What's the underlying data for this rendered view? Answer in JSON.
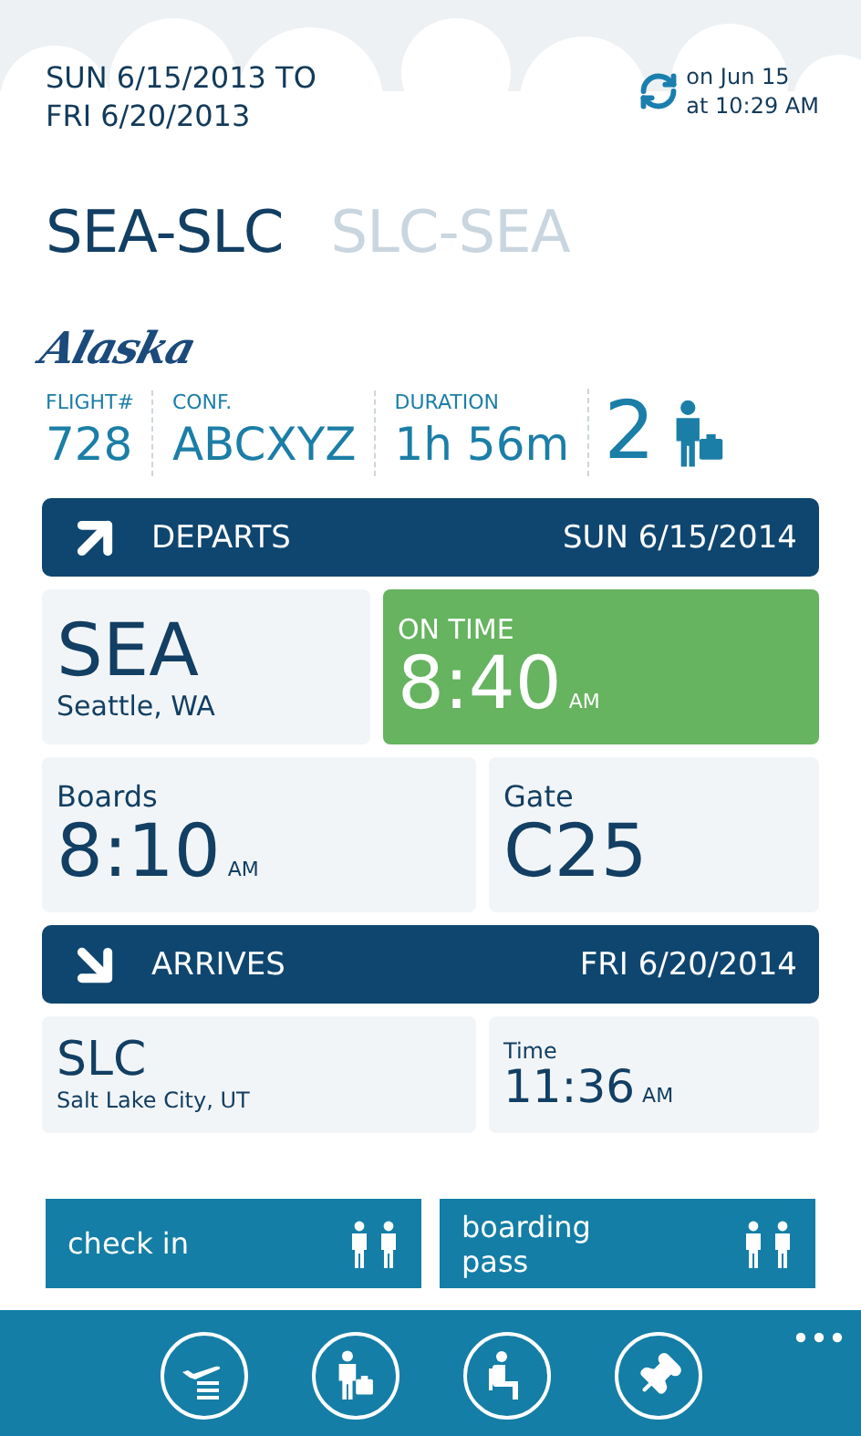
{
  "header": {
    "date_range": [
      "SUN 6/15/2013 TO",
      "FRI 6/20/2013"
    ],
    "updated": [
      "on Jun 15",
      "at 10:29 AM"
    ]
  },
  "routes": [
    {
      "label": "SEA-SLC",
      "selected": true
    },
    {
      "label": "SLC-SEA",
      "selected": false
    }
  ],
  "airline": "Alaska",
  "stats": [
    {
      "label": "FLIGHT#",
      "value": "728"
    },
    {
      "label": "CONF.",
      "value": "ABCXYZ"
    },
    {
      "label": "DURATION",
      "value": "1h 56m"
    }
  ],
  "passengers": "2",
  "departs": {
    "label": "DEPARTS",
    "date": "SUN 6/15/2014",
    "airport": "SEA",
    "city": "Seattle, WA",
    "status": {
      "kind": "on_time",
      "label": "ON TIME",
      "time": "8:40",
      "ampm": "AM"
    },
    "boards": {
      "label": "Boards",
      "time": "8:10",
      "ampm": "AM"
    },
    "gate": {
      "label": "Gate",
      "value": "C25"
    }
  },
  "arrives": {
    "label": "ARRIVES",
    "date": "FRI 6/20/2014",
    "airport": "SLC",
    "city": "Salt Lake City, UT",
    "time": {
      "label": "Time",
      "time": "11:36",
      "ampm": "AM"
    }
  },
  "actions": [
    {
      "label": "check in"
    },
    {
      "label": "boarding pass"
    }
  ],
  "app_bar": [
    {
      "kind": "flights"
    },
    {
      "kind": "traveler"
    },
    {
      "kind": "seat"
    },
    {
      "kind": "pin"
    }
  ]
}
